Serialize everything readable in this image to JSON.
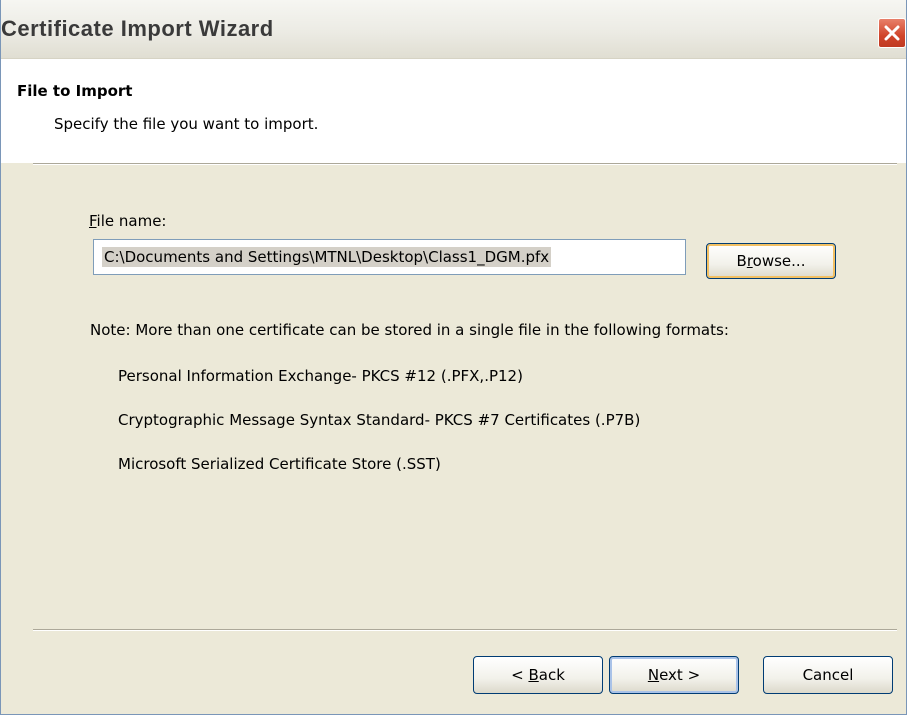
{
  "window": {
    "title": "Certificate Import Wizard"
  },
  "header": {
    "title": "File to Import",
    "subtitle": "Specify the file you want to import."
  },
  "file": {
    "label_mnemonic": "F",
    "label_rest": "ile name:",
    "value": "C:\\Documents and Settings\\MTNL\\Desktop\\Class1_DGM.pfx"
  },
  "browse": {
    "pre": "B",
    "mnemonic": "r",
    "post": "owse..."
  },
  "note": "Note:  More than one certificate can be stored in a single file in the following formats:",
  "formats": [
    "Personal Information Exchange- PKCS #12 (.PFX,.P12)",
    "Cryptographic Message Syntax Standard- PKCS #7 Certificates (.P7B)",
    "Microsoft Serialized Certificate Store (.SST)"
  ],
  "buttons": {
    "back": {
      "pre": "< ",
      "mnemonic": "B",
      "post": "ack"
    },
    "next": {
      "mnemonic": "N",
      "post": "ext >"
    },
    "cancel": "Cancel"
  },
  "icons": {
    "close": "close-icon"
  },
  "colors": {
    "dialog_bg": "#ece9d8",
    "close_button": "#d0452b",
    "selection": "#d4d0c8"
  }
}
